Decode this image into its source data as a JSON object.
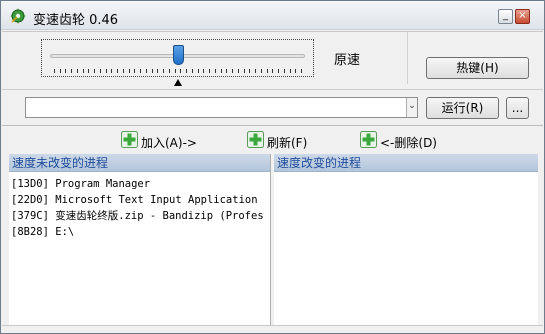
{
  "window": {
    "title": "变速齿轮 0.46",
    "min_glyph": "_",
    "close_glyph": "×"
  },
  "speed": {
    "slider_value": 0.5,
    "label": "原速"
  },
  "buttons": {
    "hotkey": "热键(H)",
    "run": "运行(R)",
    "more": "..."
  },
  "combo": {
    "value": "",
    "arrow": "⌄"
  },
  "actions": {
    "add": "加入(A)->",
    "refresh": "刷新(F)",
    "remove": "<-删除(D)"
  },
  "panels": {
    "unchanged_title": "速度未改变的进程",
    "changed_title": "速度改变的进程",
    "unchanged_processes": [
      "[13D0]  Program Manager",
      "[22D0]  Microsoft Text Input Application",
      "[379C]  变速齿轮终版.zip - Bandizip (Profes",
      "[8B28]  E:\\"
    ],
    "changed_processes": []
  },
  "colors": {
    "accent": "#1e4b9a",
    "header_bg": "#c3d3e6",
    "plus_icon": "#3aa83a"
  }
}
